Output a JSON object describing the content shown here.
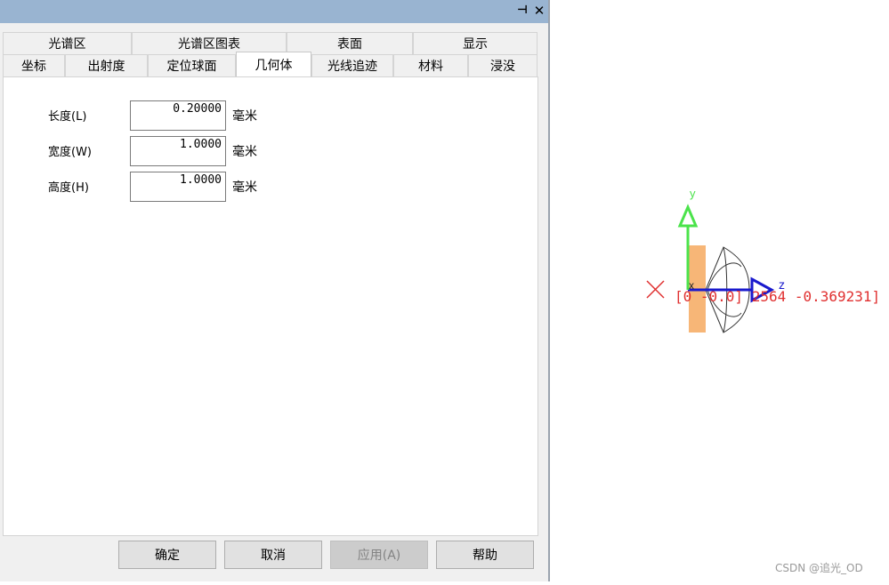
{
  "tabs_row1": [
    "光谱区",
    "光谱区图表",
    "表面",
    "显示"
  ],
  "tabs_row2": [
    "坐标",
    "出射度",
    "定位球面",
    "几何体",
    "光线追迹",
    "材料",
    "浸没"
  ],
  "active_tab": "几何体",
  "fields": [
    {
      "label": "长度(L)",
      "value": "0.20000",
      "unit": "毫米"
    },
    {
      "label": "宽度(W)",
      "value": "1.0000",
      "unit": "毫米"
    },
    {
      "label": "高度(H)",
      "value": "1.0000",
      "unit": "毫米"
    }
  ],
  "buttons": {
    "ok": "确定",
    "cancel": "取消",
    "apply": "应用(A)",
    "help": "帮助"
  },
  "viewport": {
    "axis_y": "y",
    "axis_z": "z",
    "axis_x": "x",
    "coord_text": "[0  -0.0]  2564  -0.369231]",
    "colors": {
      "y_axis": "#4be34b",
      "z_axis": "#1a1acd",
      "object": "#f7b677",
      "marker": "#e03030"
    }
  },
  "watermark": "CSDN @追光_OD",
  "icons": {
    "pin": "pin-icon",
    "close": "close-icon"
  }
}
